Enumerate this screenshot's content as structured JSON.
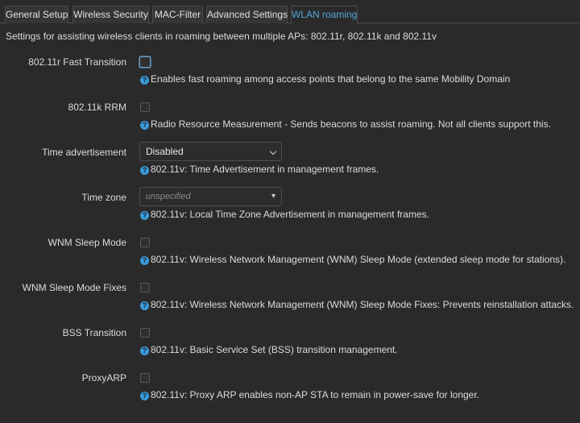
{
  "tabs": [
    {
      "label": "General Setup"
    },
    {
      "label": "Wireless Security"
    },
    {
      "label": "MAC-Filter"
    },
    {
      "label": "Advanced Settings"
    },
    {
      "label": "WLAN roaming"
    }
  ],
  "active_tab": "WLAN roaming",
  "description": "Settings for assisting wireless clients in roaming between multiple APs: 802.11r, 802.11k and 802.11v",
  "help_icon_glyph": "?",
  "fields": [
    {
      "label": "802.11r Fast Transition",
      "type": "checkbox",
      "checked": false,
      "help": "Enables fast roaming among access points that belong to the same Mobility Domain"
    },
    {
      "label": "802.11k RRM",
      "type": "checkbox",
      "checked": false,
      "help": "Radio Resource Measurement - Sends beacons to assist roaming. Not all clients support this."
    },
    {
      "label": "Time advertisement",
      "type": "select",
      "value": "Disabled",
      "help": "802.11v: Time Advertisement in management frames."
    },
    {
      "label": "Time zone",
      "type": "select",
      "placeholder": "unspecified",
      "help": "802.11v: Local Time Zone Advertisement in management frames."
    },
    {
      "label": "WNM Sleep Mode",
      "type": "checkbox",
      "checked": false,
      "help": "802.11v: Wireless Network Management (WNM) Sleep Mode (extended sleep mode for stations)."
    },
    {
      "label": "WNM Sleep Mode Fixes",
      "type": "checkbox",
      "checked": false,
      "help": "802.11v: Wireless Network Management (WNM) Sleep Mode Fixes: Prevents reinstallation attacks."
    },
    {
      "label": "BSS Transition",
      "type": "checkbox",
      "checked": false,
      "help": "802.11v: Basic Service Set (BSS) transition management."
    },
    {
      "label": "ProxyARP",
      "type": "checkbox",
      "checked": false,
      "help": "802.11v: Proxy ARP enables non-AP STA to remain in power-save for longer."
    }
  ],
  "colors": {
    "background": "#2a2a2a",
    "active_tab_text": "#4fa9d9",
    "help_icon": "#3a9ad9"
  }
}
